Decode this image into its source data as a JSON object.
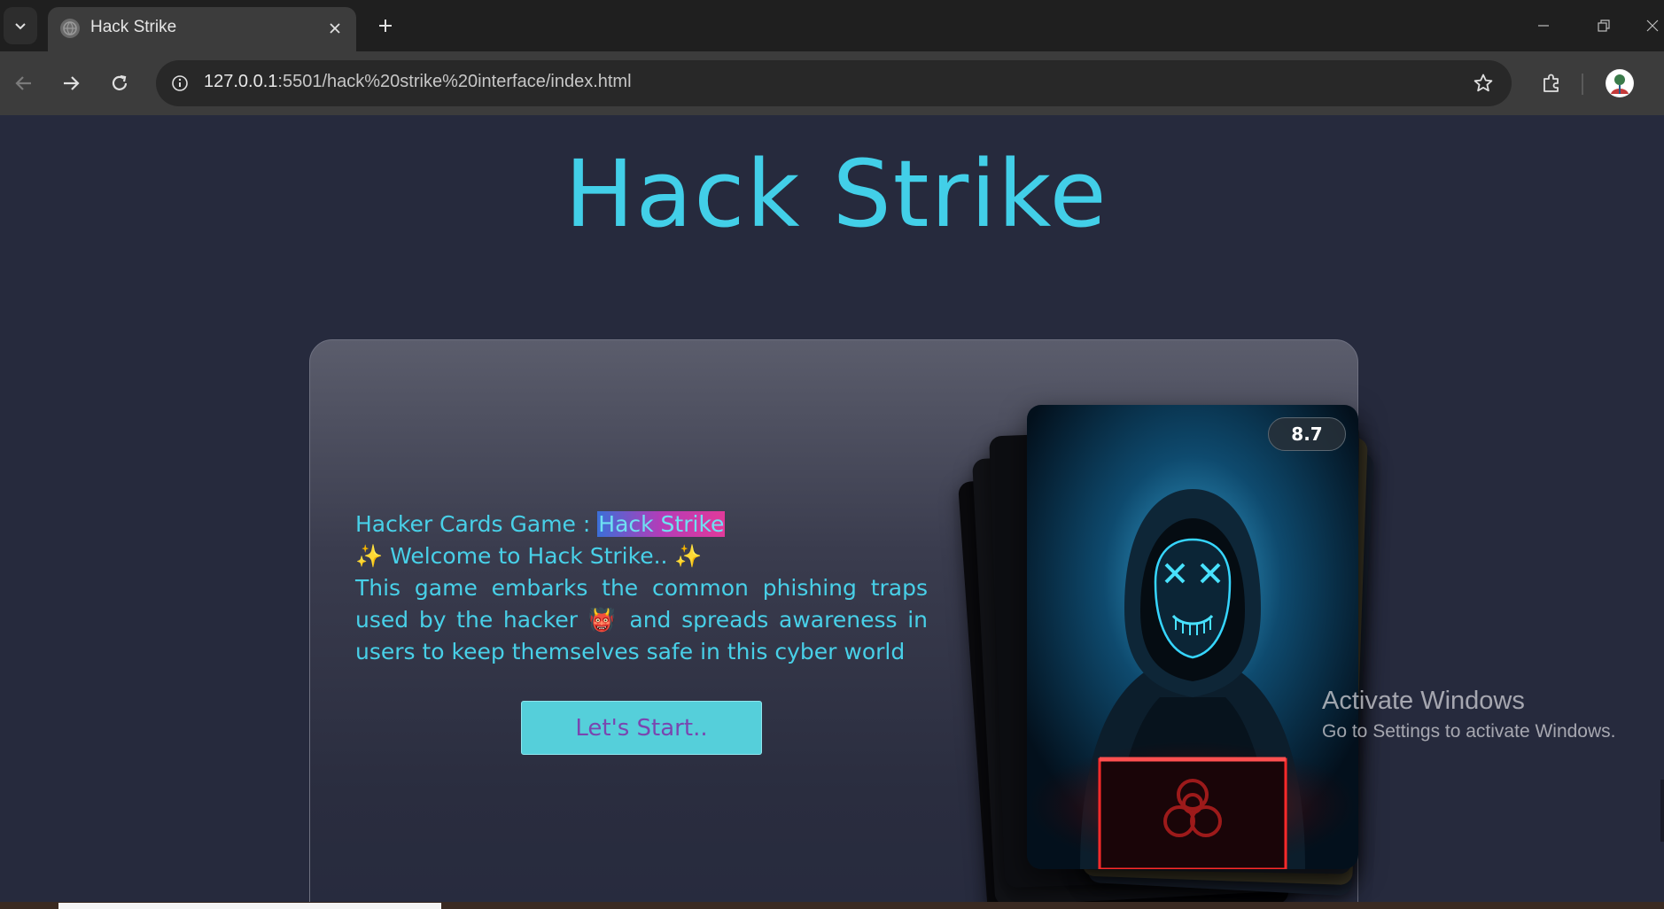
{
  "browser": {
    "tab_title": "Hack Strike",
    "url_host": "127.0.0.1",
    "url_rest": ":5501/hack%20strike%20interface/index.html"
  },
  "page": {
    "title": "Hack Strike",
    "intro_prefix": "Hacker Cards Game : ",
    "intro_highlight": "Hack Strike",
    "welcome": "✨ Welcome to Hack Strike.. ✨",
    "desc_part1": "This game embarks the common phishing traps used by the hacker ",
    "desc_emoji": "👹",
    "desc_part2": " and spreads awareness in users to keep themselves safe in this cyber world",
    "start_button": "Let's Start..",
    "card_rating": "8.7"
  },
  "watermark": {
    "line1": "Activate Windows",
    "line2": "Go to Settings to activate Windows."
  },
  "colors": {
    "title": "#42cfe8",
    "text": "#48d0e8",
    "button_bg": "#55cfda",
    "button_text": "#7a46b0",
    "page_bg": "#262a3d"
  },
  "icons": {
    "tab_list": "chevron-down-icon",
    "favicon": "globe-icon",
    "tab_close": "close-icon",
    "new_tab": "plus-icon",
    "back": "arrow-left-icon",
    "forward": "arrow-right-icon",
    "reload": "reload-icon",
    "site_info": "info-icon",
    "bookmark": "star-icon",
    "extensions": "puzzle-icon",
    "profile": "avatar"
  }
}
